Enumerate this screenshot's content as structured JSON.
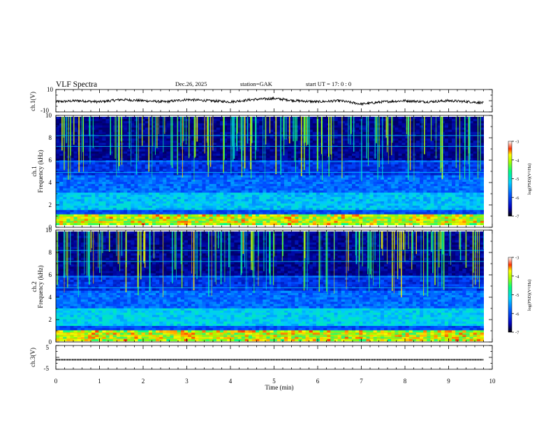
{
  "header": {
    "title": "VLF  Spectra",
    "date": "Dec.26, 2025",
    "station": "station=GAK",
    "start_ut": "start  UT  =    17: 0   : 0"
  },
  "chart_data": [
    {
      "type": "line",
      "name": "ch1-voltage",
      "ylabel": "ch.1(V)",
      "ylim": [
        -10,
        10
      ],
      "yticks": [
        "10",
        "-10"
      ],
      "xlim": [
        0,
        10
      ],
      "x": [
        0,
        0.5,
        1,
        1.5,
        2,
        2.5,
        3,
        3.5,
        4,
        4.5,
        5,
        5.5,
        6,
        6.5,
        7,
        7.5,
        8,
        8.5,
        9,
        9.5,
        9.8
      ],
      "y": [
        -1,
        0,
        -1,
        1,
        0,
        -1,
        1,
        0,
        -1,
        1,
        2,
        0,
        -1,
        0,
        -3,
        -1,
        0,
        -1,
        0,
        -1,
        -2
      ],
      "color": "#000000"
    },
    {
      "type": "heatmap",
      "name": "ch1-spectrogram",
      "ylabel": "Frequency  (kHz)",
      "ylabel2": "ch.1",
      "ylim": [
        0,
        10
      ],
      "yticks": [
        "0",
        "2",
        "4",
        "6",
        "8",
        "10"
      ],
      "xlim": [
        0,
        9.8
      ],
      "colorbar": {
        "label": "log(PSD)(V²/Hz)",
        "ticks": [
          "-3",
          "-4",
          "-5",
          "-6",
          "-7"
        ],
        "range": [
          -7,
          -3
        ]
      }
    },
    {
      "type": "heatmap",
      "name": "ch2-spectrogram",
      "ylabel": "Frequency  (kHz)",
      "ylabel2": "ch.2",
      "ylim": [
        0,
        10
      ],
      "yticks": [
        "0",
        "2",
        "4",
        "6",
        "8",
        "10"
      ],
      "xlim": [
        0,
        9.8
      ],
      "colorbar": {
        "label": "log(PSD)(V²/Hz)",
        "ticks": [
          "-3",
          "-4",
          "-5",
          "-6",
          "-7"
        ],
        "range": [
          -7,
          -3
        ]
      }
    },
    {
      "type": "line",
      "name": "ch3-voltage",
      "ylabel": "ch.3(V)",
      "ylim": [
        -5,
        5
      ],
      "yticks": [
        "5",
        "-5"
      ],
      "xlim": [
        0,
        10
      ],
      "x": [
        0,
        9.8
      ],
      "y": [
        -1,
        -1
      ],
      "color": "#000000"
    }
  ],
  "xaxis": {
    "label": "Time  (min)",
    "ticks": [
      "0",
      "1",
      "2",
      "3",
      "4",
      "5",
      "6",
      "7",
      "8",
      "9",
      "10"
    ]
  },
  "colormap": [
    "#000060",
    "#0000c0",
    "#0050ff",
    "#00c0ff",
    "#00ff90",
    "#80ff00",
    "#ffff00",
    "#ff8000",
    "#ff0000",
    "#ffffff"
  ]
}
